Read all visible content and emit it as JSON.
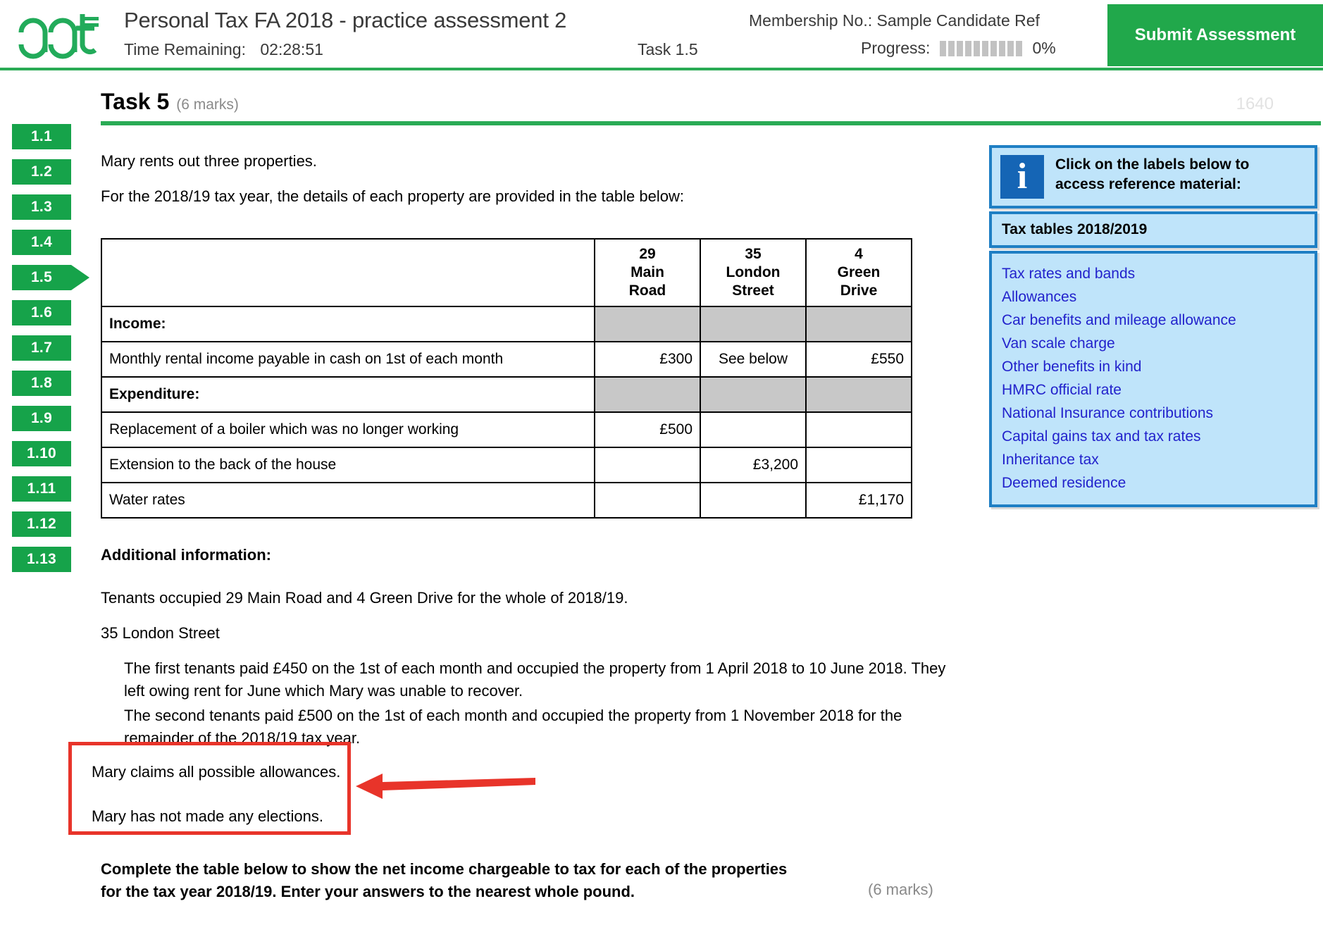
{
  "header": {
    "logo_text": "aat",
    "exam_title": "Personal Tax  FA 2018 - practice assessment 2",
    "time_label": "Time Remaining:",
    "time_value": "02:28:51",
    "task_indicator": "Task 1.5",
    "membership": "Membership No.: Sample Candidate Ref",
    "progress_label": "Progress:",
    "progress_value": "0%",
    "progress_segments": 10,
    "submit_label": "Submit Assessment",
    "accent_green": "#2aab55",
    "submit_green": "#21a84b"
  },
  "left_nav": {
    "items": [
      {
        "label": "1.1",
        "active": false
      },
      {
        "label": "1.2",
        "active": false
      },
      {
        "label": "1.3",
        "active": false
      },
      {
        "label": "1.4",
        "active": false
      },
      {
        "label": "1.5",
        "active": true
      },
      {
        "label": "1.6",
        "active": false
      },
      {
        "label": "1.7",
        "active": false
      },
      {
        "label": "1.8",
        "active": false
      },
      {
        "label": "1.9",
        "active": false
      },
      {
        "label": "1.10",
        "active": false
      },
      {
        "label": "1.11",
        "active": false
      },
      {
        "label": "1.12",
        "active": false
      },
      {
        "label": "1.13",
        "active": false
      }
    ]
  },
  "task": {
    "title": "Task 5",
    "marks": "(6 marks)",
    "code": "1640"
  },
  "intro": {
    "line1": "Mary rents out three properties.",
    "line2": "For the 2018/19 tax year, the details of each property are provided in the table below:"
  },
  "property_table": {
    "columns": [
      "",
      "29\nMain\nRoad",
      "35\nLondon\nStreet",
      "4\nGreen\nDrive"
    ],
    "col_headers": [
      {
        "l1": "29",
        "l2": "Main",
        "l3": "Road"
      },
      {
        "l1": "35",
        "l2": "London",
        "l3": "Street"
      },
      {
        "l1": "4",
        "l2": "Green",
        "l3": "Drive"
      }
    ],
    "rows": [
      {
        "type": "section",
        "label": "Income:",
        "cells": [
          "",
          "",
          ""
        ]
      },
      {
        "type": "data",
        "label": "Monthly rental income payable in cash on 1st of each month",
        "cells": [
          "£300",
          "See below",
          "£550"
        ]
      },
      {
        "type": "section",
        "label": "Expenditure:",
        "cells": [
          "",
          "",
          ""
        ]
      },
      {
        "type": "data",
        "label": "Replacement of a boiler which was no longer working",
        "cells": [
          "£500",
          "",
          ""
        ]
      },
      {
        "type": "data",
        "label": "Extension to the back of the house",
        "cells": [
          "",
          "£3,200",
          ""
        ]
      },
      {
        "type": "data",
        "label": "Water rates",
        "cells": [
          "",
          "",
          "£1,170"
        ]
      }
    ]
  },
  "additional": {
    "heading": "Additional information:",
    "line1": "Tenants occupied 29 Main Road and 4 Green Drive for the whole of 2018/19.",
    "line2": "35 London Street",
    "indent1": "The first tenants paid £450 on the 1st of each month and occupied the property from 1 April 2018 to 10 June 2018. They left owing rent for June which Mary was unable to recover.",
    "indent2": "The second tenants paid £500 on the 1st of each month and occupied the property from 1 November 2018 for the remainder of the 2018/19 tax year."
  },
  "annotation": {
    "line1": "Mary claims all possible allowances.",
    "line2": "Mary has not made any elections.",
    "box_color": "#e8342a",
    "arrow_color": "#e8342a"
  },
  "instruction": {
    "text": "Complete the table below to show the net income chargeable to tax for each of the properties for the tax year 2018/19. Enter your answers to the nearest whole pound.",
    "marks": "(6 marks)"
  },
  "reference_panel": {
    "info_icon": "info-icon",
    "info_text_line1": "Click on the labels below to",
    "info_text_line2": "access reference material:",
    "tax_tables_label": "Tax tables 2018/2019",
    "links": [
      "Tax rates and bands",
      "Allowances",
      "Car benefits and mileage allowance",
      "Van scale charge",
      "Other benefits in kind",
      "HMRC official rate",
      "National Insurance contributions",
      "Capital gains tax and tax rates",
      "Inheritance tax",
      "Deemed residence"
    ],
    "panel_bg": "#bfe4fa",
    "panel_border": "#1f7fc4",
    "link_color": "#2222cc"
  }
}
